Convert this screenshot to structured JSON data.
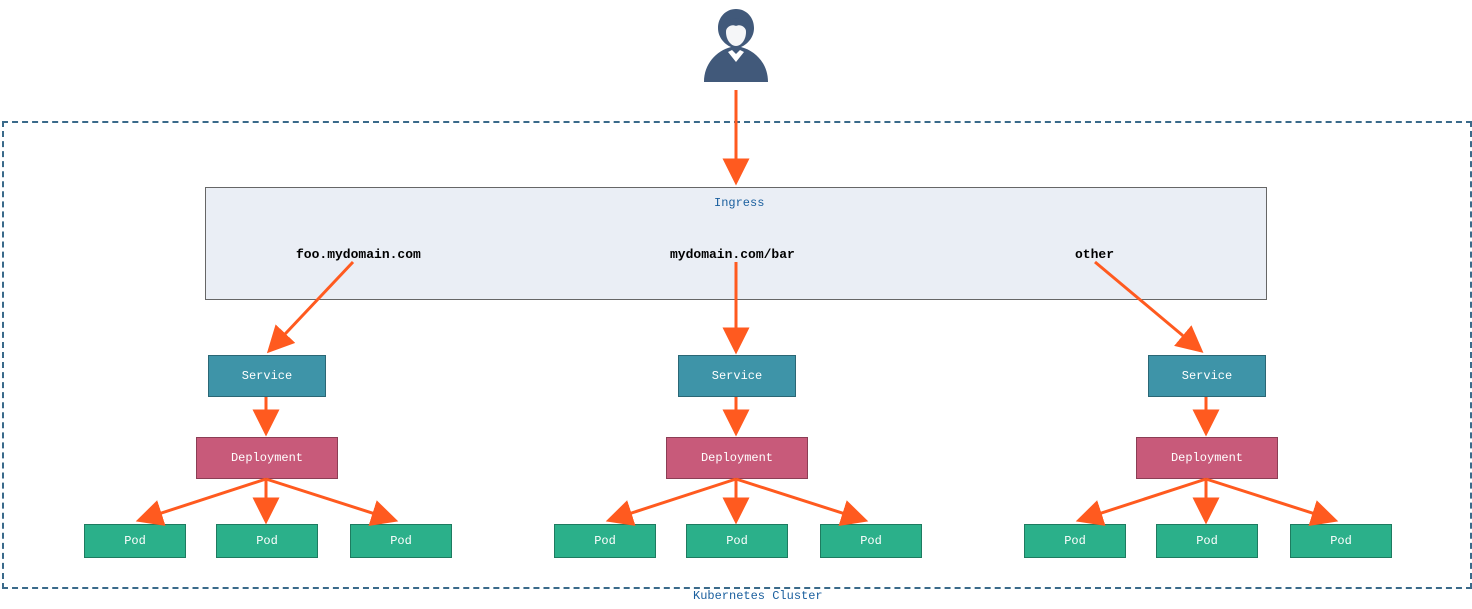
{
  "cluster": {
    "label": "Kubernetes Cluster"
  },
  "ingress": {
    "title": "Ingress",
    "rules": [
      "foo.mydomain.com",
      "mydomain.com/bar",
      "other"
    ]
  },
  "nodes": {
    "service": "Service",
    "deployment": "Deployment",
    "pod": "Pod"
  }
}
